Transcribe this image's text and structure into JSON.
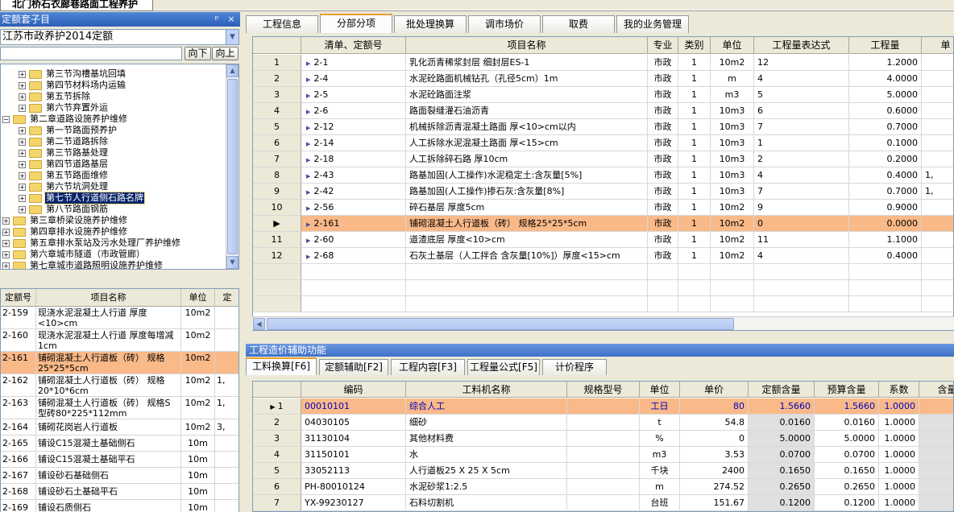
{
  "window": {
    "doc_tab_title": "北门桥石衣廊巷路面工程养护"
  },
  "left_panel": {
    "title": "定额套子目",
    "title_ctrl_pin": "ᵖ",
    "title_ctrl_close": "×",
    "quota_select": "江苏市政养护2014定额",
    "search_placeholder": "",
    "btn_down": "向下",
    "btn_up": "向上",
    "tree": [
      {
        "level": 2,
        "label": "第三节沟槽基坑回填",
        "expanded": false
      },
      {
        "level": 2,
        "label": "第四节材料场内运输",
        "expanded": false
      },
      {
        "level": 2,
        "label": "第五节拆除",
        "expanded": false
      },
      {
        "level": 2,
        "label": "第六节弃置外运",
        "expanded": false
      },
      {
        "level": 1,
        "label": "第二章道路设施养护维修",
        "expanded": true
      },
      {
        "level": 2,
        "label": "第一节路面预养护",
        "expanded": false
      },
      {
        "level": 2,
        "label": "第二节道路拆除",
        "expanded": false
      },
      {
        "level": 2,
        "label": "第三节路基处理",
        "expanded": false
      },
      {
        "level": 2,
        "label": "第四节道路基层",
        "expanded": false
      },
      {
        "level": 2,
        "label": "第五节路面维修",
        "expanded": false
      },
      {
        "level": 2,
        "label": "第六节坑洞处理",
        "expanded": false
      },
      {
        "level": 2,
        "label": "第七节人行道侧石路名牌",
        "expanded": false,
        "selected": true
      },
      {
        "level": 2,
        "label": "第八节路面钢筋",
        "expanded": false
      },
      {
        "level": 1,
        "label": "第三章桥梁设施养护维修",
        "expanded": false
      },
      {
        "level": 1,
        "label": "第四章排水设施养护维修",
        "expanded": false
      },
      {
        "level": 1,
        "label": "第五章排水泵站及污水处理厂养护维修",
        "expanded": false
      },
      {
        "level": 1,
        "label": "第六章城市隧道（市政管廊）",
        "expanded": false
      },
      {
        "level": 1,
        "label": "第七章城市道路照明设施养护维修",
        "expanded": false
      }
    ],
    "table": {
      "headers": [
        "定额号",
        "项目名称",
        "单位",
        "定"
      ],
      "rows": [
        {
          "code": "2-159",
          "name": "现浇水泥混凝土人行道 厚度<10>cm",
          "unit": "10m2",
          "extra": "",
          "selected": false,
          "h": 28
        },
        {
          "code": "2-160",
          "name": "现浇水泥混凝土人行道 厚度每增减1cm",
          "unit": "10m2",
          "extra": "",
          "selected": false,
          "h": 28
        },
        {
          "code": "2-161",
          "name": "铺砌混凝土人行道板（砖） 规格25*25*5cm",
          "unit": "10m2",
          "extra": "",
          "selected": true,
          "h": 28
        },
        {
          "code": "2-162",
          "name": "铺砌混凝土人行道板（砖） 规格20*10*6cm",
          "unit": "10m2",
          "extra": "1,",
          "selected": false,
          "h": 28
        },
        {
          "code": "2-163",
          "name": "铺砌混凝土人行道板（砖） 规格S型砖80*225*112mm",
          "unit": "10m2",
          "extra": "1,",
          "selected": false,
          "h": 28
        },
        {
          "code": "2-164",
          "name": "铺砌花岗岩人行道板",
          "unit": "10m2",
          "extra": "3,",
          "selected": false,
          "h": 20
        },
        {
          "code": "2-165",
          "name": "铺设C15混凝土基础侧石",
          "unit": "10m",
          "extra": "",
          "selected": false,
          "h": 20
        },
        {
          "code": "2-166",
          "name": "铺设C15混凝土基础平石",
          "unit": "10m",
          "extra": "",
          "selected": false,
          "h": 20
        },
        {
          "code": "2-167",
          "name": "铺设砂石基础侧石",
          "unit": "10m",
          "extra": "",
          "selected": false,
          "h": 20
        },
        {
          "code": "2-168",
          "name": "铺设砂石土基础平石",
          "unit": "10m",
          "extra": "",
          "selected": false,
          "h": 20
        },
        {
          "code": "2-169",
          "name": "铺设石质侧石",
          "unit": "10m",
          "extra": "",
          "selected": false,
          "h": 20
        },
        {
          "code": "2-170",
          "name": "铺设石质平石",
          "unit": "10m",
          "extra": "",
          "selected": false,
          "h": 20
        }
      ]
    }
  },
  "main_tabs": [
    {
      "label": "工程信息",
      "active": false
    },
    {
      "label": "分部分项",
      "active": true
    },
    {
      "label": "批处理换算",
      "active": false
    },
    {
      "label": "调市场价",
      "active": false
    },
    {
      "label": "取费",
      "active": false
    },
    {
      "label": "我的业务管理",
      "active": false
    }
  ],
  "main_grid": {
    "headers": [
      "",
      "清单、定额号",
      "项目名称",
      "专业",
      "类别",
      "单位",
      "工程量表达式",
      "工程量",
      "单"
    ],
    "rows": [
      {
        "no": "1",
        "code": "2-1",
        "name": "乳化沥青稀浆封层 细封层ES-1",
        "spec": "市政",
        "cat": "1",
        "unit": "10m2",
        "expr": "12",
        "qty": "1.2000",
        "extra": "",
        "selected": false
      },
      {
        "no": "2",
        "code": "2-4",
        "name": "水泥砼路面机械钻孔（孔径5cm）1m",
        "spec": "市政",
        "cat": "1",
        "unit": "m",
        "expr": "4",
        "qty": "4.0000",
        "extra": "",
        "selected": false
      },
      {
        "no": "3",
        "code": "2-5",
        "name": "水泥砼路面注浆",
        "spec": "市政",
        "cat": "1",
        "unit": "m3",
        "expr": "5",
        "qty": "5.0000",
        "extra": "",
        "selected": false
      },
      {
        "no": "4",
        "code": "2-6",
        "name": "路面裂缝灌石油沥青",
        "spec": "市政",
        "cat": "1",
        "unit": "10m3",
        "expr": "6",
        "qty": "0.6000",
        "extra": "",
        "selected": false
      },
      {
        "no": "5",
        "code": "2-12",
        "name": "机械拆除沥青混凝土路面 厚<10>cm以内",
        "spec": "市政",
        "cat": "1",
        "unit": "10m3",
        "expr": "7",
        "qty": "0.7000",
        "extra": "",
        "selected": false
      },
      {
        "no": "6",
        "code": "2-14",
        "name": "人工拆除水泥混凝土路面 厚<15>cm",
        "spec": "市政",
        "cat": "1",
        "unit": "10m3",
        "expr": "1",
        "qty": "0.1000",
        "extra": "",
        "selected": false
      },
      {
        "no": "7",
        "code": "2-18",
        "name": "人工拆除碎石路 厚10cm",
        "spec": "市政",
        "cat": "1",
        "unit": "10m3",
        "expr": "2",
        "qty": "0.2000",
        "extra": "",
        "selected": false
      },
      {
        "no": "8",
        "code": "2-43",
        "name": "路基加固(人工操作)水泥稳定土:含灰量[5%]",
        "spec": "市政",
        "cat": "1",
        "unit": "10m3",
        "expr": "4",
        "qty": "0.4000",
        "extra": "1,",
        "selected": false
      },
      {
        "no": "9",
        "code": "2-42",
        "name": "路基加固(人工操作)掺石灰:含灰量[8%]",
        "spec": "市政",
        "cat": "1",
        "unit": "10m3",
        "expr": "7",
        "qty": "0.7000",
        "extra": "1,",
        "selected": false
      },
      {
        "no": "10",
        "code": "2-56",
        "name": "碎石基层 厚度5cm",
        "spec": "市政",
        "cat": "1",
        "unit": "10m2",
        "expr": "9",
        "qty": "0.9000",
        "extra": "",
        "selected": false
      },
      {
        "no": "▶",
        "code": "2-161",
        "name": "铺砌混凝土人行道板（砖） 规格25*25*5cm",
        "spec": "市政",
        "cat": "1",
        "unit": "10m2",
        "expr": "0",
        "qty": "0.0000",
        "extra": "",
        "selected": true
      },
      {
        "no": "11",
        "code": "2-60",
        "name": "道渣底层 厚度<10>cm",
        "spec": "市政",
        "cat": "1",
        "unit": "10m2",
        "expr": "11",
        "qty": "1.1000",
        "extra": "",
        "selected": false
      },
      {
        "no": "12",
        "code": "2-68",
        "name": "石灰土基层（人工拌合 含灰量[10%]）厚度<15>cm",
        "spec": "市政",
        "cat": "1",
        "unit": "10m2",
        "expr": "4",
        "qty": "0.4000",
        "extra": "",
        "selected": false
      }
    ]
  },
  "aux_panel": {
    "title": "工程造价辅助功能",
    "tabs": [
      {
        "label": "工料换算[F6]",
        "active": true
      },
      {
        "label": "定额辅助[F2]",
        "active": false
      },
      {
        "label": "工程内容[F3]",
        "active": false
      },
      {
        "label": "工程量公式[F5]",
        "active": false
      },
      {
        "label": "计价程序",
        "active": false
      }
    ],
    "headers": [
      "",
      "编码",
      "工料机名称",
      "规格型号",
      "单位",
      "单价",
      "定额含量",
      "预算含量",
      "系数",
      "含量"
    ],
    "rows": [
      {
        "no": "1",
        "code": "00010101",
        "name": "综合人工",
        "model": "",
        "unit": "工日",
        "price": "80",
        "quota": "1.5660",
        "budget": "1.5660",
        "coef": "1.0000",
        "selected": true
      },
      {
        "no": "2",
        "code": "04030105",
        "name": "细砂",
        "model": "",
        "unit": "t",
        "price": "54.8",
        "quota": "0.0160",
        "budget": "0.0160",
        "coef": "1.0000",
        "selected": false
      },
      {
        "no": "3",
        "code": "31130104",
        "name": "其他材料费",
        "model": "",
        "unit": "%",
        "price": "0",
        "quota": "5.0000",
        "budget": "5.0000",
        "coef": "1.0000",
        "selected": false
      },
      {
        "no": "4",
        "code": "31150101",
        "name": "水",
        "model": "",
        "unit": "m3",
        "price": "3.53",
        "quota": "0.0700",
        "budget": "0.0700",
        "coef": "1.0000",
        "selected": false
      },
      {
        "no": "5",
        "code": "33052113",
        "name": "人行道板25 X 25 X 5cm",
        "model": "",
        "unit": "千块",
        "price": "2400",
        "quota": "0.1650",
        "budget": "0.1650",
        "coef": "1.0000",
        "selected": false
      },
      {
        "no": "6",
        "code": "PH-80010124",
        "name": "水泥砂浆1:2.5",
        "model": "",
        "unit": "m",
        "price": "274.52",
        "quota": "0.2650",
        "budget": "0.2650",
        "coef": "1.0000",
        "selected": false
      },
      {
        "no": "7",
        "code": "YX-99230127",
        "name": "石料切割机",
        "model": "",
        "unit": "台班",
        "price": "151.67",
        "quota": "0.1200",
        "budget": "0.1200",
        "coef": "1.0000",
        "selected": false
      }
    ]
  }
}
